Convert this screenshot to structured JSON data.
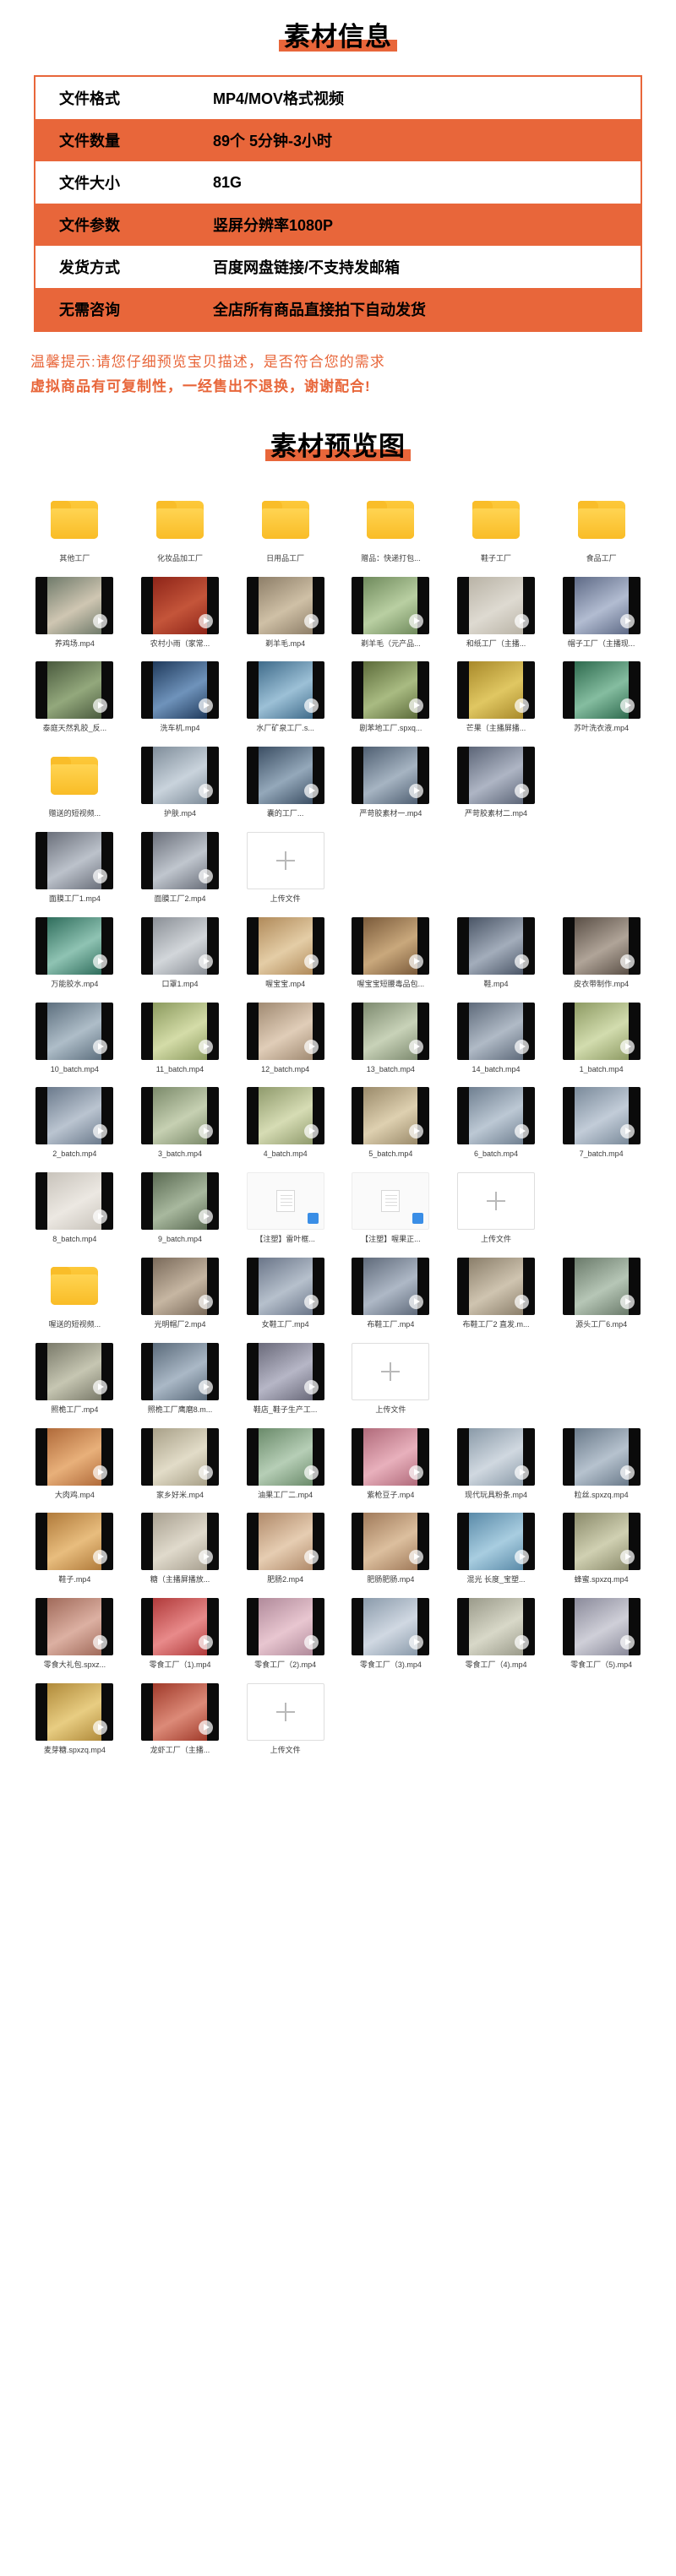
{
  "theme": {
    "accent": "#e8663a"
  },
  "sections": {
    "info_title": "素材信息",
    "preview_title": "素材预览图"
  },
  "info_table": {
    "rows": [
      {
        "key": "文件格式",
        "value": "MP4/MOV格式视频",
        "highlight": false
      },
      {
        "key": "文件数量",
        "value": "89个 5分钟-3小时",
        "highlight": true
      },
      {
        "key": "文件大小",
        "value": "81G",
        "highlight": false
      },
      {
        "key": "文件参数",
        "value": "竖屏分辨率1080P",
        "highlight": true
      },
      {
        "key": "发货方式",
        "value": "百度网盘链接/不支持发邮箱",
        "highlight": false
      },
      {
        "key": "无需咨询",
        "value": "全店所有商品直接拍下自动发货",
        "highlight": true
      }
    ]
  },
  "notice": {
    "line1": "温馨提示:请您仔细预览宝贝描述，是否符合您的需求",
    "line2": "虚拟商品有可复制性，一经售出不退换，谢谢配合!"
  },
  "preview": {
    "items": [
      {
        "label": "其他工厂",
        "kind": "folder"
      },
      {
        "label": "化妆品加工厂",
        "kind": "folder"
      },
      {
        "label": "日用品工厂",
        "kind": "folder"
      },
      {
        "label": "赠品：快递打包...",
        "kind": "folder"
      },
      {
        "label": "鞋子工厂",
        "kind": "folder"
      },
      {
        "label": "食品工厂",
        "kind": "folder"
      },
      {
        "label": "养鸡场.mp4",
        "kind": "video",
        "c1": "#6f7a6a",
        "c2": "#cfc6b2"
      },
      {
        "label": "农村小雨（家常...",
        "kind": "video",
        "c1": "#8e2418",
        "c2": "#c4553a"
      },
      {
        "label": "剃羊毛.mp4",
        "kind": "video",
        "c1": "#8d7e68",
        "c2": "#cfc0a6"
      },
      {
        "label": "剃羊毛（元产品...",
        "kind": "video",
        "c1": "#6f8a5c",
        "c2": "#b9cfa2"
      },
      {
        "label": "和纸工厂（主播...",
        "kind": "video",
        "c1": "#b9b3a6",
        "c2": "#dedad1"
      },
      {
        "label": "帽子工厂（主播现...",
        "kind": "video",
        "c1": "#5e6a86",
        "c2": "#b2bcd1"
      },
      {
        "label": "泰庭天然乳胶_反...",
        "kind": "video",
        "c1": "#4a5a3e",
        "c2": "#93a87c"
      },
      {
        "label": "洗车机.mp4",
        "kind": "video",
        "c1": "#1f3a5c",
        "c2": "#6f93bb"
      },
      {
        "label": "水厂矿泉工厂.s...",
        "kind": "video",
        "c1": "#3f6b8a",
        "c2": "#9cc0d6"
      },
      {
        "label": "剧苯地工厂.spxq...",
        "kind": "video",
        "c1": "#5c6b3a",
        "c2": "#a9bb82"
      },
      {
        "label": "芒果（主播屏播...",
        "kind": "video",
        "c1": "#a8892a",
        "c2": "#e0c762"
      },
      {
        "label": "苏叶洗衣液.mp4",
        "kind": "video",
        "c1": "#2e6a4e",
        "c2": "#85bda0"
      },
      {
        "label": "赠送的短视频...",
        "kind": "folder"
      },
      {
        "label": "护肤.mp4",
        "kind": "video",
        "c1": "#7f8d9a",
        "c2": "#c9d3dc"
      },
      {
        "label": "囊的工厂...",
        "kind": "video",
        "c1": "#3b4e63",
        "c2": "#94a8ba"
      },
      {
        "label": "严苛胶素材一.mp4",
        "kind": "video",
        "c1": "#4f5f72",
        "c2": "#a6b4c2"
      },
      {
        "label": "严苛胶素材二.mp4",
        "kind": "video",
        "c1": "#5c6577",
        "c2": "#aeb5c4"
      },
      {
        "label": "",
        "kind": "empty"
      },
      {
        "label": "面膜工厂1.mp4",
        "kind": "video",
        "c1": "#6a6f7a",
        "c2": "#bcc2cb"
      },
      {
        "label": "面膜工厂2.mp4",
        "kind": "video",
        "c1": "#6a6f7a",
        "c2": "#c0c6ce"
      },
      {
        "label": "上传文件",
        "kind": "add"
      },
      {
        "label": "",
        "kind": "empty"
      },
      {
        "label": "",
        "kind": "empty"
      },
      {
        "label": "",
        "kind": "empty"
      },
      {
        "label": "万能胶水.mp4",
        "kind": "video",
        "c1": "#2f6d5c",
        "c2": "#8fc3b3"
      },
      {
        "label": "口罩1.mp4",
        "kind": "video",
        "c1": "#8a8f96",
        "c2": "#d2d6da"
      },
      {
        "label": "喔宝宝.mp4",
        "kind": "video",
        "c1": "#b08a5a",
        "c2": "#e4cda6"
      },
      {
        "label": "喔宝宝短腰毒品包...",
        "kind": "video",
        "c1": "#7a5a3a",
        "c2": "#c9a87c"
      },
      {
        "label": "鞋.mp4",
        "kind": "video",
        "c1": "#4a5566",
        "c2": "#a3adbb"
      },
      {
        "label": "皮衣带制作.mp4",
        "kind": "video",
        "c1": "#5a4f46",
        "c2": "#b0a498"
      },
      {
        "label": "10_batch.mp4",
        "kind": "video",
        "c1": "#5d6f7e",
        "c2": "#aebdc8"
      },
      {
        "label": "11_batch.mp4",
        "kind": "video",
        "c1": "#8b9a5e",
        "c2": "#d4dca8"
      },
      {
        "label": "12_batch.mp4",
        "kind": "video",
        "c1": "#a08a72",
        "c2": "#e0cdb8"
      },
      {
        "label": "13_batch.mp4",
        "kind": "video",
        "c1": "#7d8a6f",
        "c2": "#c8d2b8"
      },
      {
        "label": "14_batch.mp4",
        "kind": "video",
        "c1": "#5e6a7a",
        "c2": "#b0bac6"
      },
      {
        "label": "1_batch.mp4",
        "kind": "video",
        "c1": "#8d9a63",
        "c2": "#d2dcae"
      },
      {
        "label": "2_batch.mp4",
        "kind": "video",
        "c1": "#6b7a8c",
        "c2": "#bac4d0"
      },
      {
        "label": "3_batch.mp4",
        "kind": "video",
        "c1": "#7b8a6a",
        "c2": "#c6d0b2"
      },
      {
        "label": "4_batch.mp4",
        "kind": "video",
        "c1": "#8f9a6c",
        "c2": "#d6dcb4"
      },
      {
        "label": "5_batch.mp4",
        "kind": "video",
        "c1": "#9a8a6a",
        "c2": "#ded0b0"
      },
      {
        "label": "6_batch.mp4",
        "kind": "video",
        "c1": "#6f7f90",
        "c2": "#bcc8d4"
      },
      {
        "label": "7_batch.mp4",
        "kind": "video",
        "c1": "#7a8a9a",
        "c2": "#c2ccd8"
      },
      {
        "label": "8_batch.mp4",
        "kind": "video",
        "c1": "#c8c3bb",
        "c2": "#ece8e2"
      },
      {
        "label": "9_batch.mp4",
        "kind": "video",
        "c1": "#5a6a52",
        "c2": "#a8b89e"
      },
      {
        "label": "【注塑】雷叶框...",
        "kind": "doc"
      },
      {
        "label": "【注塑】喔果正...",
        "kind": "doc"
      },
      {
        "label": "上传文件",
        "kind": "add"
      },
      {
        "label": "",
        "kind": "empty"
      },
      {
        "label": "喔送的短视频...",
        "kind": "folder"
      },
      {
        "label": "光明帽厂2.mp4",
        "kind": "video",
        "c1": "#7a6a5a",
        "c2": "#c6b6a2"
      },
      {
        "label": "女鞋工厂.mp4",
        "kind": "video",
        "c1": "#6a7588",
        "c2": "#b6c0cc"
      },
      {
        "label": "布鞋工厂.mp4",
        "kind": "video",
        "c1": "#5f6a7a",
        "c2": "#aeb8c6"
      },
      {
        "label": "布鞋工厂2 直发.m...",
        "kind": "video",
        "c1": "#8a7e6a",
        "c2": "#cfc4b0"
      },
      {
        "label": "源头工厂6.mp4",
        "kind": "video",
        "c1": "#6a7a6a",
        "c2": "#b6c6b6"
      },
      {
        "label": "照桅工厂.mp4",
        "kind": "video",
        "c1": "#7a7a6a",
        "c2": "#c6c6b2"
      },
      {
        "label": "照桅工厂鹰磨8.m...",
        "kind": "video",
        "c1": "#5a6a7a",
        "c2": "#aab8c6"
      },
      {
        "label": "鞋店_鞋子生产工...",
        "kind": "video",
        "c1": "#6a6a7a",
        "c2": "#b6b6c6"
      },
      {
        "label": "上传文件",
        "kind": "add"
      },
      {
        "label": "",
        "kind": "empty"
      },
      {
        "label": "",
        "kind": "empty"
      },
      {
        "label": "大肉鸡.mp4",
        "kind": "video",
        "c1": "#b06a3a",
        "c2": "#e8b07a"
      },
      {
        "label": "家乡好米.mp4",
        "kind": "video",
        "c1": "#a8a088",
        "c2": "#e2dcc8"
      },
      {
        "label": "油果工厂二.mp4",
        "kind": "video",
        "c1": "#6a8a6a",
        "c2": "#b6ceb6"
      },
      {
        "label": "紫枪豆子.mp4",
        "kind": "video",
        "c1": "#b06a7a",
        "c2": "#e8b0bc"
      },
      {
        "label": "现代玩具粉条.mp4",
        "kind": "video",
        "c1": "#8a9aa8",
        "c2": "#d0d8e0"
      },
      {
        "label": "粒丝.spxzq.mp4",
        "kind": "video",
        "c1": "#6a7a8a",
        "c2": "#b6c2ce"
      },
      {
        "label": "鞋子.mp4",
        "kind": "video",
        "c1": "#b07a3a",
        "c2": "#e8bd7e"
      },
      {
        "label": "糖（主播屏播放...",
        "kind": "video",
        "c1": "#a8a090",
        "c2": "#e0dacc"
      },
      {
        "label": "肥肠2.mp4",
        "kind": "video",
        "c1": "#b08a6a",
        "c2": "#e6cdb2"
      },
      {
        "label": "肥肠肥肠.mp4",
        "kind": "video",
        "c1": "#a07a5a",
        "c2": "#dcbf9e"
      },
      {
        "label": "混光 长度_宝塑...",
        "kind": "video",
        "c1": "#5a8aa8",
        "c2": "#a8cde0"
      },
      {
        "label": "蜂蜜.spxzq.mp4",
        "kind": "video",
        "c1": "#8a8a6a",
        "c2": "#d0d0b2"
      },
      {
        "label": "零食大礼包.spxz...",
        "kind": "video",
        "c1": "#a06a5a",
        "c2": "#dcb0a2"
      },
      {
        "label": "零食工厂（1).mp4",
        "kind": "video",
        "c1": "#b03a3a",
        "c2": "#e88a8a"
      },
      {
        "label": "零食工厂（2).mp4",
        "kind": "video",
        "c1": "#b08a9a",
        "c2": "#e8c6d0"
      },
      {
        "label": "零食工厂（3).mp4",
        "kind": "video",
        "c1": "#8a9aaa",
        "c2": "#d0d8e2"
      },
      {
        "label": "零食工厂（4).mp4",
        "kind": "video",
        "c1": "#9a9a8a",
        "c2": "#d8d8c8"
      },
      {
        "label": "零食工厂（5).mp4",
        "kind": "video",
        "c1": "#8a8a9a",
        "c2": "#cfcfd8"
      },
      {
        "label": "麦芽糖.spxzq.mp4",
        "kind": "video",
        "c1": "#b08a3a",
        "c2": "#e8cd82"
      },
      {
        "label": "龙虾工厂（主播...",
        "kind": "video",
        "c1": "#a03a2a",
        "c2": "#dc8a78"
      },
      {
        "label": "上传文件",
        "kind": "add"
      },
      {
        "label": "",
        "kind": "empty"
      },
      {
        "label": "",
        "kind": "empty"
      },
      {
        "label": "",
        "kind": "empty"
      }
    ]
  }
}
